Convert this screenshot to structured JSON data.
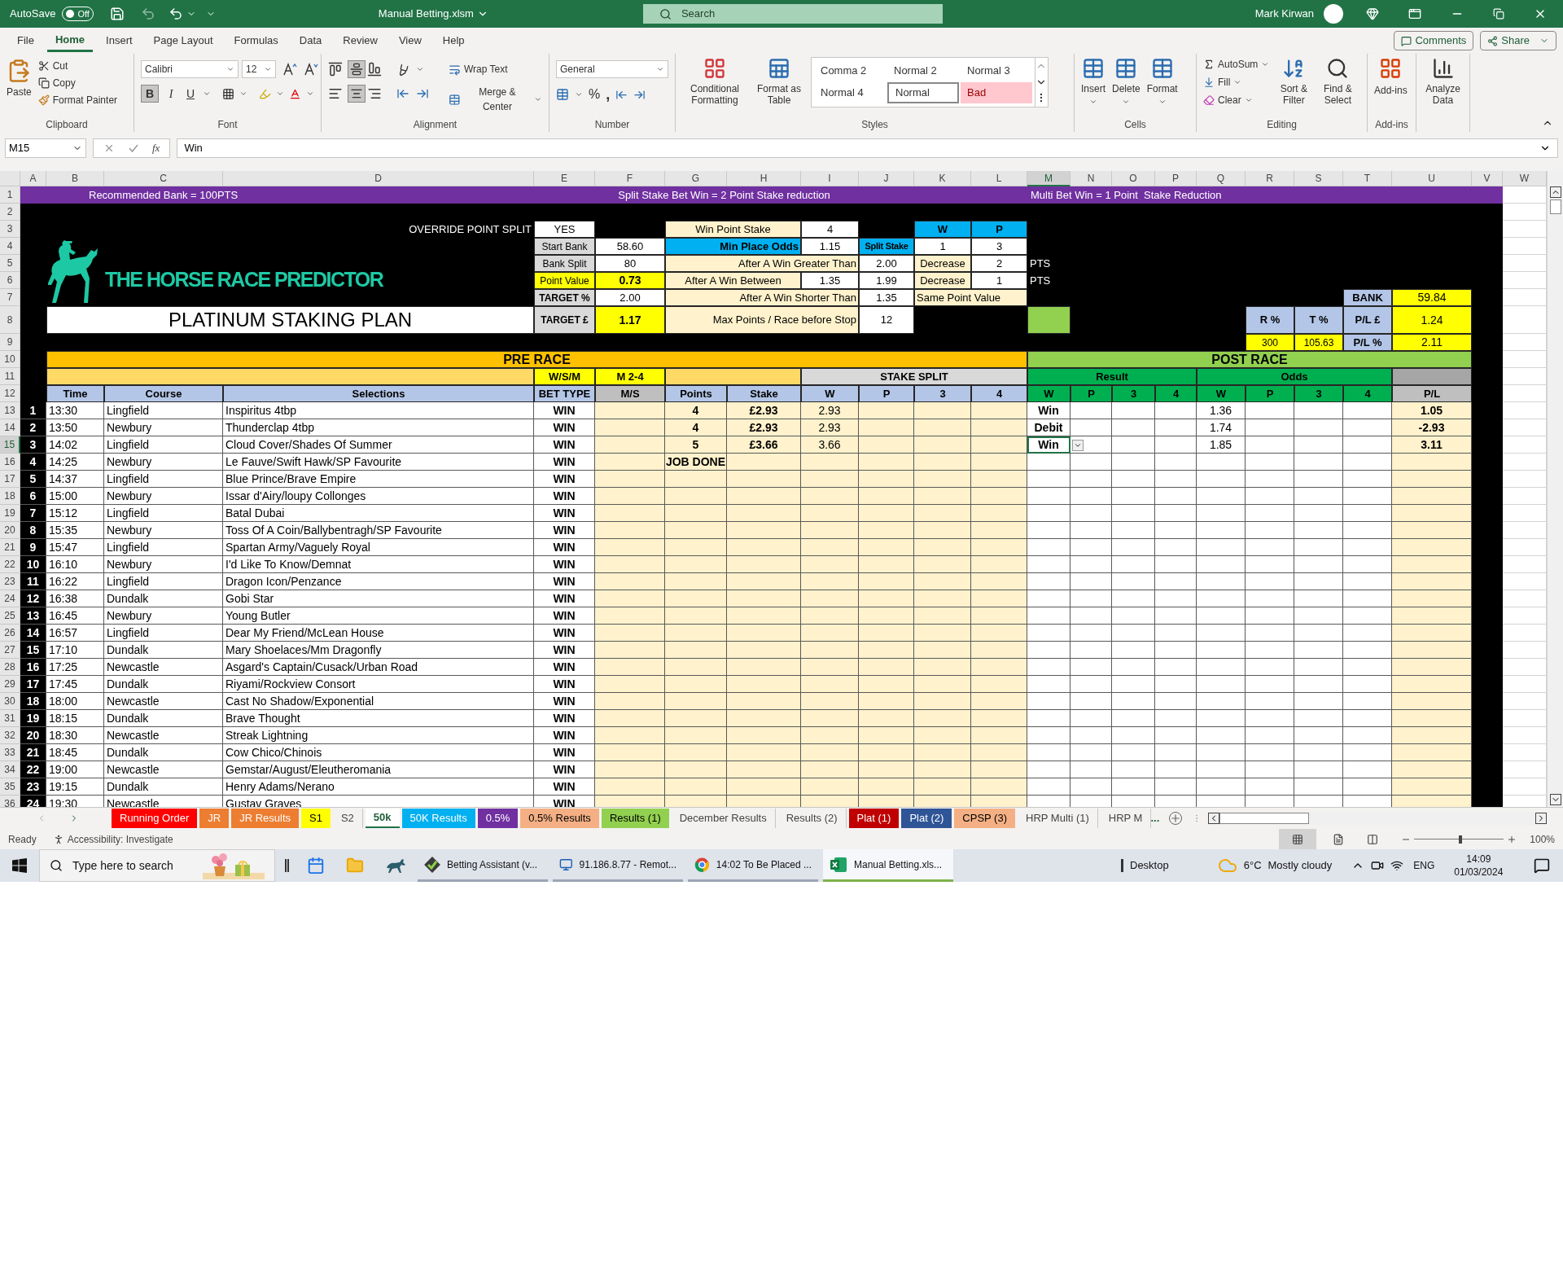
{
  "title_bar": {
    "autosave": "AutoSave",
    "autosave_on": false,
    "autosave_state": "Off",
    "file_name": "Manual Betting.xlsm",
    "search_placeholder": "Search",
    "user": "Mark Kirwan"
  },
  "ribbon": {
    "tabs": [
      {
        "label": "File",
        "selected": false
      },
      {
        "label": "Home",
        "selected": true
      },
      {
        "label": "Insert",
        "selected": false
      },
      {
        "label": "Page Layout",
        "selected": false
      },
      {
        "label": "Formulas",
        "selected": false
      },
      {
        "label": "Data",
        "selected": false
      },
      {
        "label": "Review",
        "selected": false
      },
      {
        "label": "View",
        "selected": false
      },
      {
        "label": "Help",
        "selected": false
      }
    ],
    "comments": "Comments",
    "share": "Share",
    "clipboard": {
      "label": "Clipboard",
      "paste": "Paste",
      "cut": "Cut",
      "copy": "Copy",
      "format_painter": "Format Painter"
    },
    "font": {
      "label": "Font",
      "name": "Calibri",
      "size": "12",
      "bold": "B",
      "italic": "I",
      "underline": "U",
      "bold_on": true
    },
    "alignment": {
      "label": "Alignment",
      "wrap": "Wrap Text",
      "merge": "Merge & Center",
      "middle_on": true,
      "center_on": true
    },
    "number": {
      "label": "Number",
      "format": "General",
      "percent": "%",
      "comma": ","
    },
    "styles": {
      "label": "Styles",
      "conditional": "Conditional Formatting",
      "format_table": "Format as Table",
      "items": [
        {
          "label": "Comma 2",
          "kind": "plain"
        },
        {
          "label": "Normal 2",
          "kind": "plain"
        },
        {
          "label": "Normal 3",
          "kind": "plain"
        },
        {
          "label": "Normal 4",
          "kind": "plain"
        },
        {
          "label": "Normal",
          "kind": "current"
        },
        {
          "label": "Bad",
          "kind": "bad"
        }
      ]
    },
    "cells": {
      "label": "Cells",
      "insert": "Insert",
      "delete": "Delete",
      "format": "Format"
    },
    "editing": {
      "label": "Editing",
      "autosum": "AutoSum",
      "fill": "Fill",
      "clear": "Clear",
      "sort": "Sort & Filter",
      "find": "Find & Select"
    },
    "addins": {
      "label": "Add-ins",
      "addins": "Add-ins",
      "analyze": "Analyze Data"
    }
  },
  "formula_bar": {
    "name_box": "M15",
    "function_label": "fx",
    "value": "Win"
  },
  "columns": [
    "A",
    "B",
    "C",
    "D",
    "E",
    "F",
    "G",
    "H",
    "I",
    "J",
    "K",
    "L",
    "M",
    "N",
    "O",
    "P",
    "Q",
    "R",
    "S",
    "T",
    "U",
    "V",
    "W"
  ],
  "rows": [
    "1",
    "2",
    "3",
    "4",
    "5",
    "6",
    "7",
    "8",
    "9",
    "10",
    "11",
    "12",
    "13",
    "14",
    "15",
    "16",
    "17",
    "18",
    "19",
    "20",
    "21",
    "22",
    "23",
    "24",
    "25",
    "26",
    "27",
    "28",
    "29",
    "30",
    "31",
    "32",
    "33",
    "34",
    "35",
    "36"
  ],
  "cells": [
    {
      "text": "Recommended Bank = 100PTS",
      "kind": "banner-indent"
    },
    {
      "text": "Split Stake Bet Win = 2 Point Stake reduction",
      "kind": "banner-center"
    },
    {
      "text": "Multi Bet Win = 1 Point  Stake Reduction",
      "kind": "banner-left"
    },
    {
      "text": "OVERRIDE POINT SPLIT",
      "kind": "label-dark"
    },
    {
      "text": "YES",
      "kind": "value-white"
    },
    {
      "text": "Win Point Stake",
      "kind": "label-cream"
    },
    {
      "text": "4",
      "kind": "value-white"
    },
    {
      "text": "W",
      "kind": "head-cyan"
    },
    {
      "text": "P",
      "kind": "head-cyan"
    },
    {
      "text": "Start Bank",
      "kind": "label-gray"
    },
    {
      "text": "58.60",
      "kind": "value-white"
    },
    {
      "text": "Min Place Odds",
      "kind": "head-cyan-right"
    },
    {
      "text": "1.15",
      "kind": "value-white"
    },
    {
      "text": "Split Stake",
      "kind": "head-cyan-small"
    },
    {
      "text": "1",
      "kind": "value-white"
    },
    {
      "text": "3",
      "kind": "value-white"
    },
    {
      "text": "Bank Split",
      "kind": "label-gray"
    },
    {
      "text": "80",
      "kind": "value-white"
    },
    {
      "text": "After A Win Greater Than",
      "kind": "label-cream-right"
    },
    {
      "text": "2.00",
      "kind": "value-white"
    },
    {
      "text": "Decrease",
      "kind": "label-cream"
    },
    {
      "text": "2",
      "kind": "value-white"
    },
    {
      "text": "PTS",
      "kind": "label-dark-left"
    },
    {
      "text": "Point Value",
      "kind": "label-yellow"
    },
    {
      "text": "0.73",
      "kind": "value-yellow-bold"
    },
    {
      "text": "After A Win Between",
      "kind": "label-cream"
    },
    {
      "text": "1.35",
      "kind": "value-white"
    },
    {
      "text": "1.99",
      "kind": "value-white"
    },
    {
      "text": "Decrease",
      "kind": "label-cream"
    },
    {
      "text": "1",
      "kind": "value-white"
    },
    {
      "text": "PTS",
      "kind": "label-dark-left"
    },
    {
      "text": "TARGET %",
      "kind": "label-gray-bold"
    },
    {
      "text": "2.00",
      "kind": "value-white"
    },
    {
      "text": "After A Win Shorter Than",
      "kind": "label-cream-right"
    },
    {
      "text": "1.35",
      "kind": "value-white"
    },
    {
      "text": "Same Point Value",
      "kind": "label-cream-left"
    },
    {
      "text": "BANK",
      "kind": "head-blue"
    },
    {
      "text": "59.84",
      "kind": "value-yellow"
    },
    {
      "text": "THE HORSE RACE PREDICTOR",
      "kind": "logo"
    },
    {
      "text": "PLATINUM STAKING PLAN",
      "kind": "title"
    },
    {
      "text": "TARGET £",
      "kind": "label-gray-bold"
    },
    {
      "text": "1.17",
      "kind": "value-yellow-bold"
    },
    {
      "text": "Max Points / Race before Stop",
      "kind": "label-cream-right"
    },
    {
      "text": "12",
      "kind": "value-white"
    },
    {
      "kind": "block-green"
    },
    {
      "text": "R %",
      "kind": "head-blue"
    },
    {
      "text": "T %",
      "kind": "head-blue"
    },
    {
      "text": "P/L  £",
      "kind": "head-blue"
    },
    {
      "text": "1.24",
      "kind": "value-yellow"
    },
    {
      "text": "300",
      "kind": "value-yellow-small"
    },
    {
      "text": "105.63",
      "kind": "value-yellow-small"
    },
    {
      "text": "P/L %",
      "kind": "head-blue"
    },
    {
      "text": "2.11",
      "kind": "value-yellow"
    },
    {
      "text": "PRE RACE",
      "kind": "section-orange"
    },
    {
      "text": "POST RACE",
      "kind": "section-green"
    },
    {
      "kind": "band-orange"
    },
    {
      "text": "W/S/M",
      "kind": "band-yellow"
    },
    {
      "text": "M 2-4",
      "kind": "band-yellow"
    },
    {
      "kind": "band-orange"
    },
    {
      "text": "STAKE SPLIT",
      "kind": "band-gray"
    },
    {
      "text": "Result",
      "kind": "band-green"
    },
    {
      "text": "Odds",
      "kind": "band-green"
    },
    {
      "kind": "band-darkgray"
    },
    {
      "text": "Time",
      "kind": "head-blue"
    },
    {
      "text": "Course",
      "kind": "head-blue"
    },
    {
      "text": "Selections",
      "kind": "head-blue"
    },
    {
      "text": "BET TYPE",
      "kind": "head-blue"
    },
    {
      "text": "M/S",
      "kind": "head-gray"
    },
    {
      "text": "Points",
      "kind": "head-blue"
    },
    {
      "text": "Stake",
      "kind": "head-blue"
    },
    {
      "text": "W",
      "kind": "head-blue"
    },
    {
      "text": "P",
      "kind": "head-blue"
    },
    {
      "text": "3",
      "kind": "head-blue"
    },
    {
      "text": "4",
      "kind": "head-blue"
    },
    {
      "text": "W",
      "kind": "head-green"
    },
    {
      "text": "P",
      "kind": "head-green"
    },
    {
      "text": "3",
      "kind": "head-green"
    },
    {
      "text": "4",
      "kind": "head-green"
    },
    {
      "text": "W",
      "kind": "head-green"
    },
    {
      "text": "P",
      "kind": "head-green"
    },
    {
      "text": "3",
      "kind": "head-green"
    },
    {
      "text": "4",
      "kind": "head-green"
    },
    {
      "text": "P/L",
      "kind": "head-gray"
    }
  ],
  "races": [
    {
      "num": "1",
      "time": "13:30",
      "course": "Lingfield",
      "selection": "Inspiritus 4tbp",
      "bet_type": "WIN",
      "points": "4",
      "stake": "£2.93",
      "w": "2.93",
      "result": "Win",
      "odds": "1.36",
      "pl": "1.05",
      "selected": false
    },
    {
      "num": "2",
      "time": "13:50",
      "course": "Newbury",
      "selection": "Thunderclap 4tbp",
      "bet_type": "WIN",
      "points": "4",
      "stake": "£2.93",
      "w": "2.93",
      "result": "Debit",
      "odds": "1.74",
      "pl": "-2.93",
      "selected": false
    },
    {
      "num": "3",
      "time": "14:02",
      "course": "Lingfield",
      "selection": "Cloud Cover/Shades Of Summer",
      "bet_type": "WIN",
      "points": "5",
      "stake": "£3.66",
      "w": "3.66",
      "result": "Win",
      "odds": "1.85",
      "pl": "3.11",
      "selected": true
    },
    {
      "num": "4",
      "time": "14:25",
      "course": "Newbury",
      "selection": "Le Fauve/Swift Hawk/SP Favourite",
      "bet_type": "WIN",
      "points": "JOB DONE",
      "selected": false
    },
    {
      "num": "5",
      "time": "14:37",
      "course": "Lingfield",
      "selection": "Blue Prince/Brave Empire",
      "bet_type": "WIN",
      "selected": false
    },
    {
      "num": "6",
      "time": "15:00",
      "course": "Newbury",
      "selection": "Issar d'Airy/loupy Collonges",
      "bet_type": "WIN",
      "selected": false
    },
    {
      "num": "7",
      "time": "15:12",
      "course": "Lingfield",
      "selection": "Batal Dubai",
      "bet_type": "WIN",
      "selected": false
    },
    {
      "num": "8",
      "time": "15:35",
      "course": "Newbury",
      "selection": "Toss Of A Coin/Ballybentragh/SP Favourite",
      "bet_type": "WIN",
      "selected": false
    },
    {
      "num": "9",
      "time": "15:47",
      "course": "Lingfield",
      "selection": "Spartan Army/Vaguely Royal",
      "bet_type": "WIN",
      "selected": false
    },
    {
      "num": "10",
      "time": "16:10",
      "course": "Newbury",
      "selection": "I'd Like To Know/Demnat",
      "bet_type": "WIN",
      "selected": false
    },
    {
      "num": "11",
      "time": "16:22",
      "course": "Lingfield",
      "selection": "Dragon Icon/Penzance",
      "bet_type": "WIN",
      "selected": false
    },
    {
      "num": "12",
      "time": "16:38",
      "course": "Dundalk",
      "selection": "Gobi Star",
      "bet_type": "WIN",
      "selected": false
    },
    {
      "num": "13",
      "time": "16:45",
      "course": "Newbury",
      "selection": "Young Butler",
      "bet_type": "WIN",
      "selected": false
    },
    {
      "num": "14",
      "time": "16:57",
      "course": "Lingfield",
      "selection": "Dear My Friend/McLean House",
      "bet_type": "WIN",
      "selected": false
    },
    {
      "num": "15",
      "time": "17:10",
      "course": "Dundalk",
      "selection": "Mary Shoelaces/Mm Dragonfly",
      "bet_type": "WIN",
      "selected": false
    },
    {
      "num": "16",
      "time": "17:25",
      "course": "Newcastle",
      "selection": "Asgard's Captain/Cusack/Urban Road",
      "bet_type": "WIN",
      "selected": false
    },
    {
      "num": "17",
      "time": "17:45",
      "course": "Dundalk",
      "selection": "Riyami/Rockview Consort",
      "bet_type": "WIN",
      "selected": false
    },
    {
      "num": "18",
      "time": "18:00",
      "course": "Newcastle",
      "selection": "Cast No Shadow/Exponential",
      "bet_type": "WIN",
      "selected": false
    },
    {
      "num": "19",
      "time": "18:15",
      "course": "Dundalk",
      "selection": "Brave Thought",
      "bet_type": "WIN",
      "selected": false
    },
    {
      "num": "20",
      "time": "18:30",
      "course": "Newcastle",
      "selection": "Streak Lightning",
      "bet_type": "WIN",
      "selected": false
    },
    {
      "num": "21",
      "time": "18:45",
      "course": "Dundalk",
      "selection": "Cow Chico/Chinois",
      "bet_type": "WIN",
      "selected": false
    },
    {
      "num": "22",
      "time": "19:00",
      "course": "Newcastle",
      "selection": "Gemstar/August/Eleutheromania",
      "bet_type": "WIN",
      "selected": false
    },
    {
      "num": "23",
      "time": "19:15",
      "course": "Dundalk",
      "selection": "Henry Adams/Nerano",
      "bet_type": "WIN",
      "selected": false
    },
    {
      "num": "24",
      "time": "19:30",
      "course": "Newcastle",
      "selection": "Gustav Graves",
      "bet_type": "WIN",
      "selected": false
    }
  ],
  "sheet_tabs": [
    {
      "label": "Running Order",
      "color": "#ff0000",
      "selected": false
    },
    {
      "label": "JR",
      "color": "#ed7d31",
      "selected": false
    },
    {
      "label": "JR Results",
      "color": "#ed7d31",
      "selected": false
    },
    {
      "label": "S1",
      "color": "#ffff00",
      "selected": false
    },
    {
      "label": "S2",
      "selected": false
    },
    {
      "label": "50k",
      "selected": true
    },
    {
      "label": "50K Results",
      "color": "#00b0f0",
      "selected": false
    },
    {
      "label": "0.5%",
      "color": "#7030a0",
      "selected": false
    },
    {
      "label": "0.5% Results",
      "color": "#f4b084",
      "selected": false
    },
    {
      "label": "Results (1)",
      "color": "#92d050",
      "selected": false
    },
    {
      "label": "December Results",
      "selected": false
    },
    {
      "label": "Results (2)",
      "selected": false
    },
    {
      "label": "Plat (1)",
      "color": "#c00000",
      "selected": false
    },
    {
      "label": "Plat (2)",
      "color": "#2f5597",
      "selected": false
    },
    {
      "label": "CPSP (3)",
      "color": "#f4b084",
      "selected": false
    },
    {
      "label": "HRP Multi (1)",
      "selected": false
    },
    {
      "label": "HRP M",
      "selected": false
    }
  ],
  "more_tabs": "...",
  "status_bar": {
    "ready": "Ready",
    "accessibility": "Accessibility: Investigate",
    "zoom": "100%",
    "level": 0.5
  },
  "taskbar": {
    "search_placeholder": "Type here to search",
    "apps": [
      {
        "label": "Betting Assistant (v...",
        "kind": "betting",
        "active": false
      },
      {
        "label": "91.186.8.77 - Remot...",
        "kind": "remote",
        "active": false
      },
      {
        "label": "14:02 To Be Placed ...",
        "kind": "browser",
        "active": false
      },
      {
        "label": "Manual Betting.xls...",
        "kind": "excel",
        "active": true
      }
    ],
    "desktop": "Desktop",
    "temperature": "6°C",
    "weather": "Mostly cloudy",
    "language": "ENG",
    "time": "14:09",
    "date": "01/03/2024"
  }
}
